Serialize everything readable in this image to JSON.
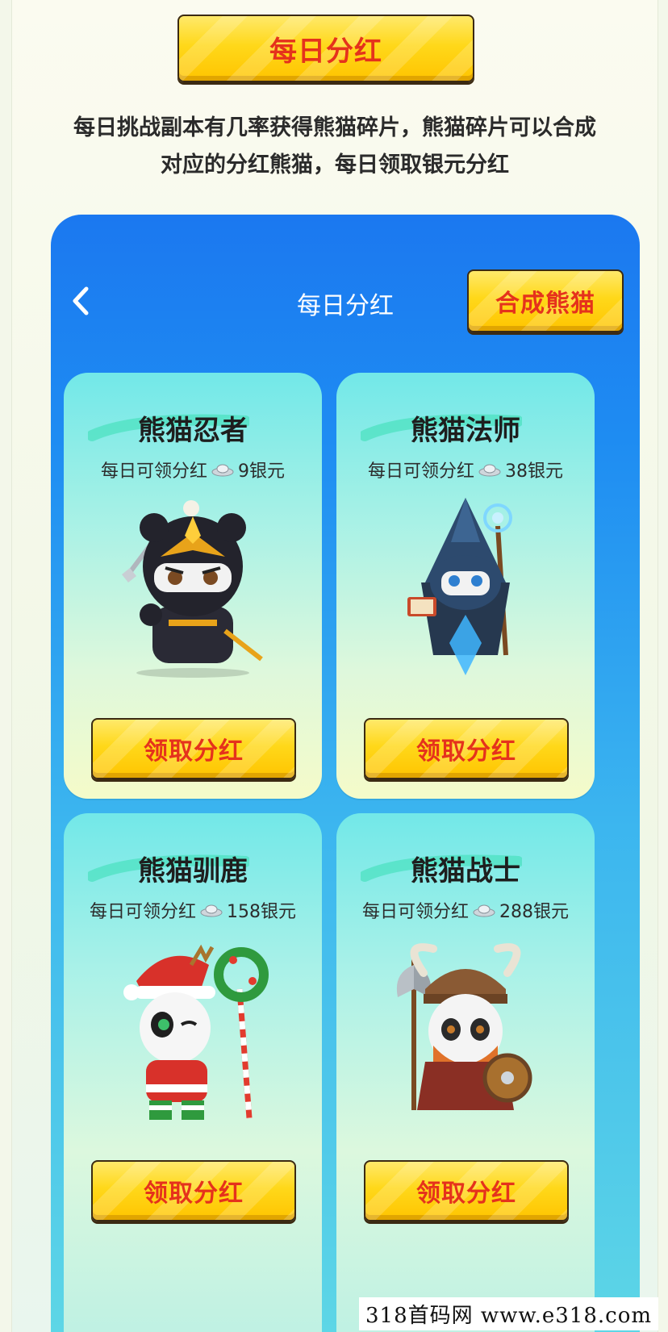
{
  "header": {
    "top_button_label": "每日分红"
  },
  "intro": {
    "line1": "每日挑战副本有几率获得熊猫碎片，熊猫碎片可以合成",
    "line2": "对应的分红熊猫，每日领取银元分红"
  },
  "panel": {
    "title": "每日分红",
    "synth_button_label": "合成熊猫",
    "back_icon": "chevron-left-icon"
  },
  "cards": [
    {
      "name": "熊猫忍者",
      "reward_prefix": "每日可领分红",
      "reward_amount": "9银元",
      "claim_label": "领取分红",
      "image": "ninja-panda"
    },
    {
      "name": "熊猫法师",
      "reward_prefix": "每日可领分红",
      "reward_amount": "38银元",
      "claim_label": "领取分红",
      "image": "mage-panda"
    },
    {
      "name": "熊猫驯鹿",
      "reward_prefix": "每日可领分红",
      "reward_amount": "158银元",
      "claim_label": "领取分红",
      "image": "reindeer-panda"
    },
    {
      "name": "熊猫战士",
      "reward_prefix": "每日可领分红",
      "reward_amount": "288银元",
      "claim_label": "领取分红",
      "image": "warrior-panda"
    }
  ],
  "watermark": "318首码网 www.e318.com",
  "colors": {
    "accent_yellow": "#ffd81a",
    "button_text_red": "#e5321c",
    "panel_blue": "#1b78f0"
  }
}
